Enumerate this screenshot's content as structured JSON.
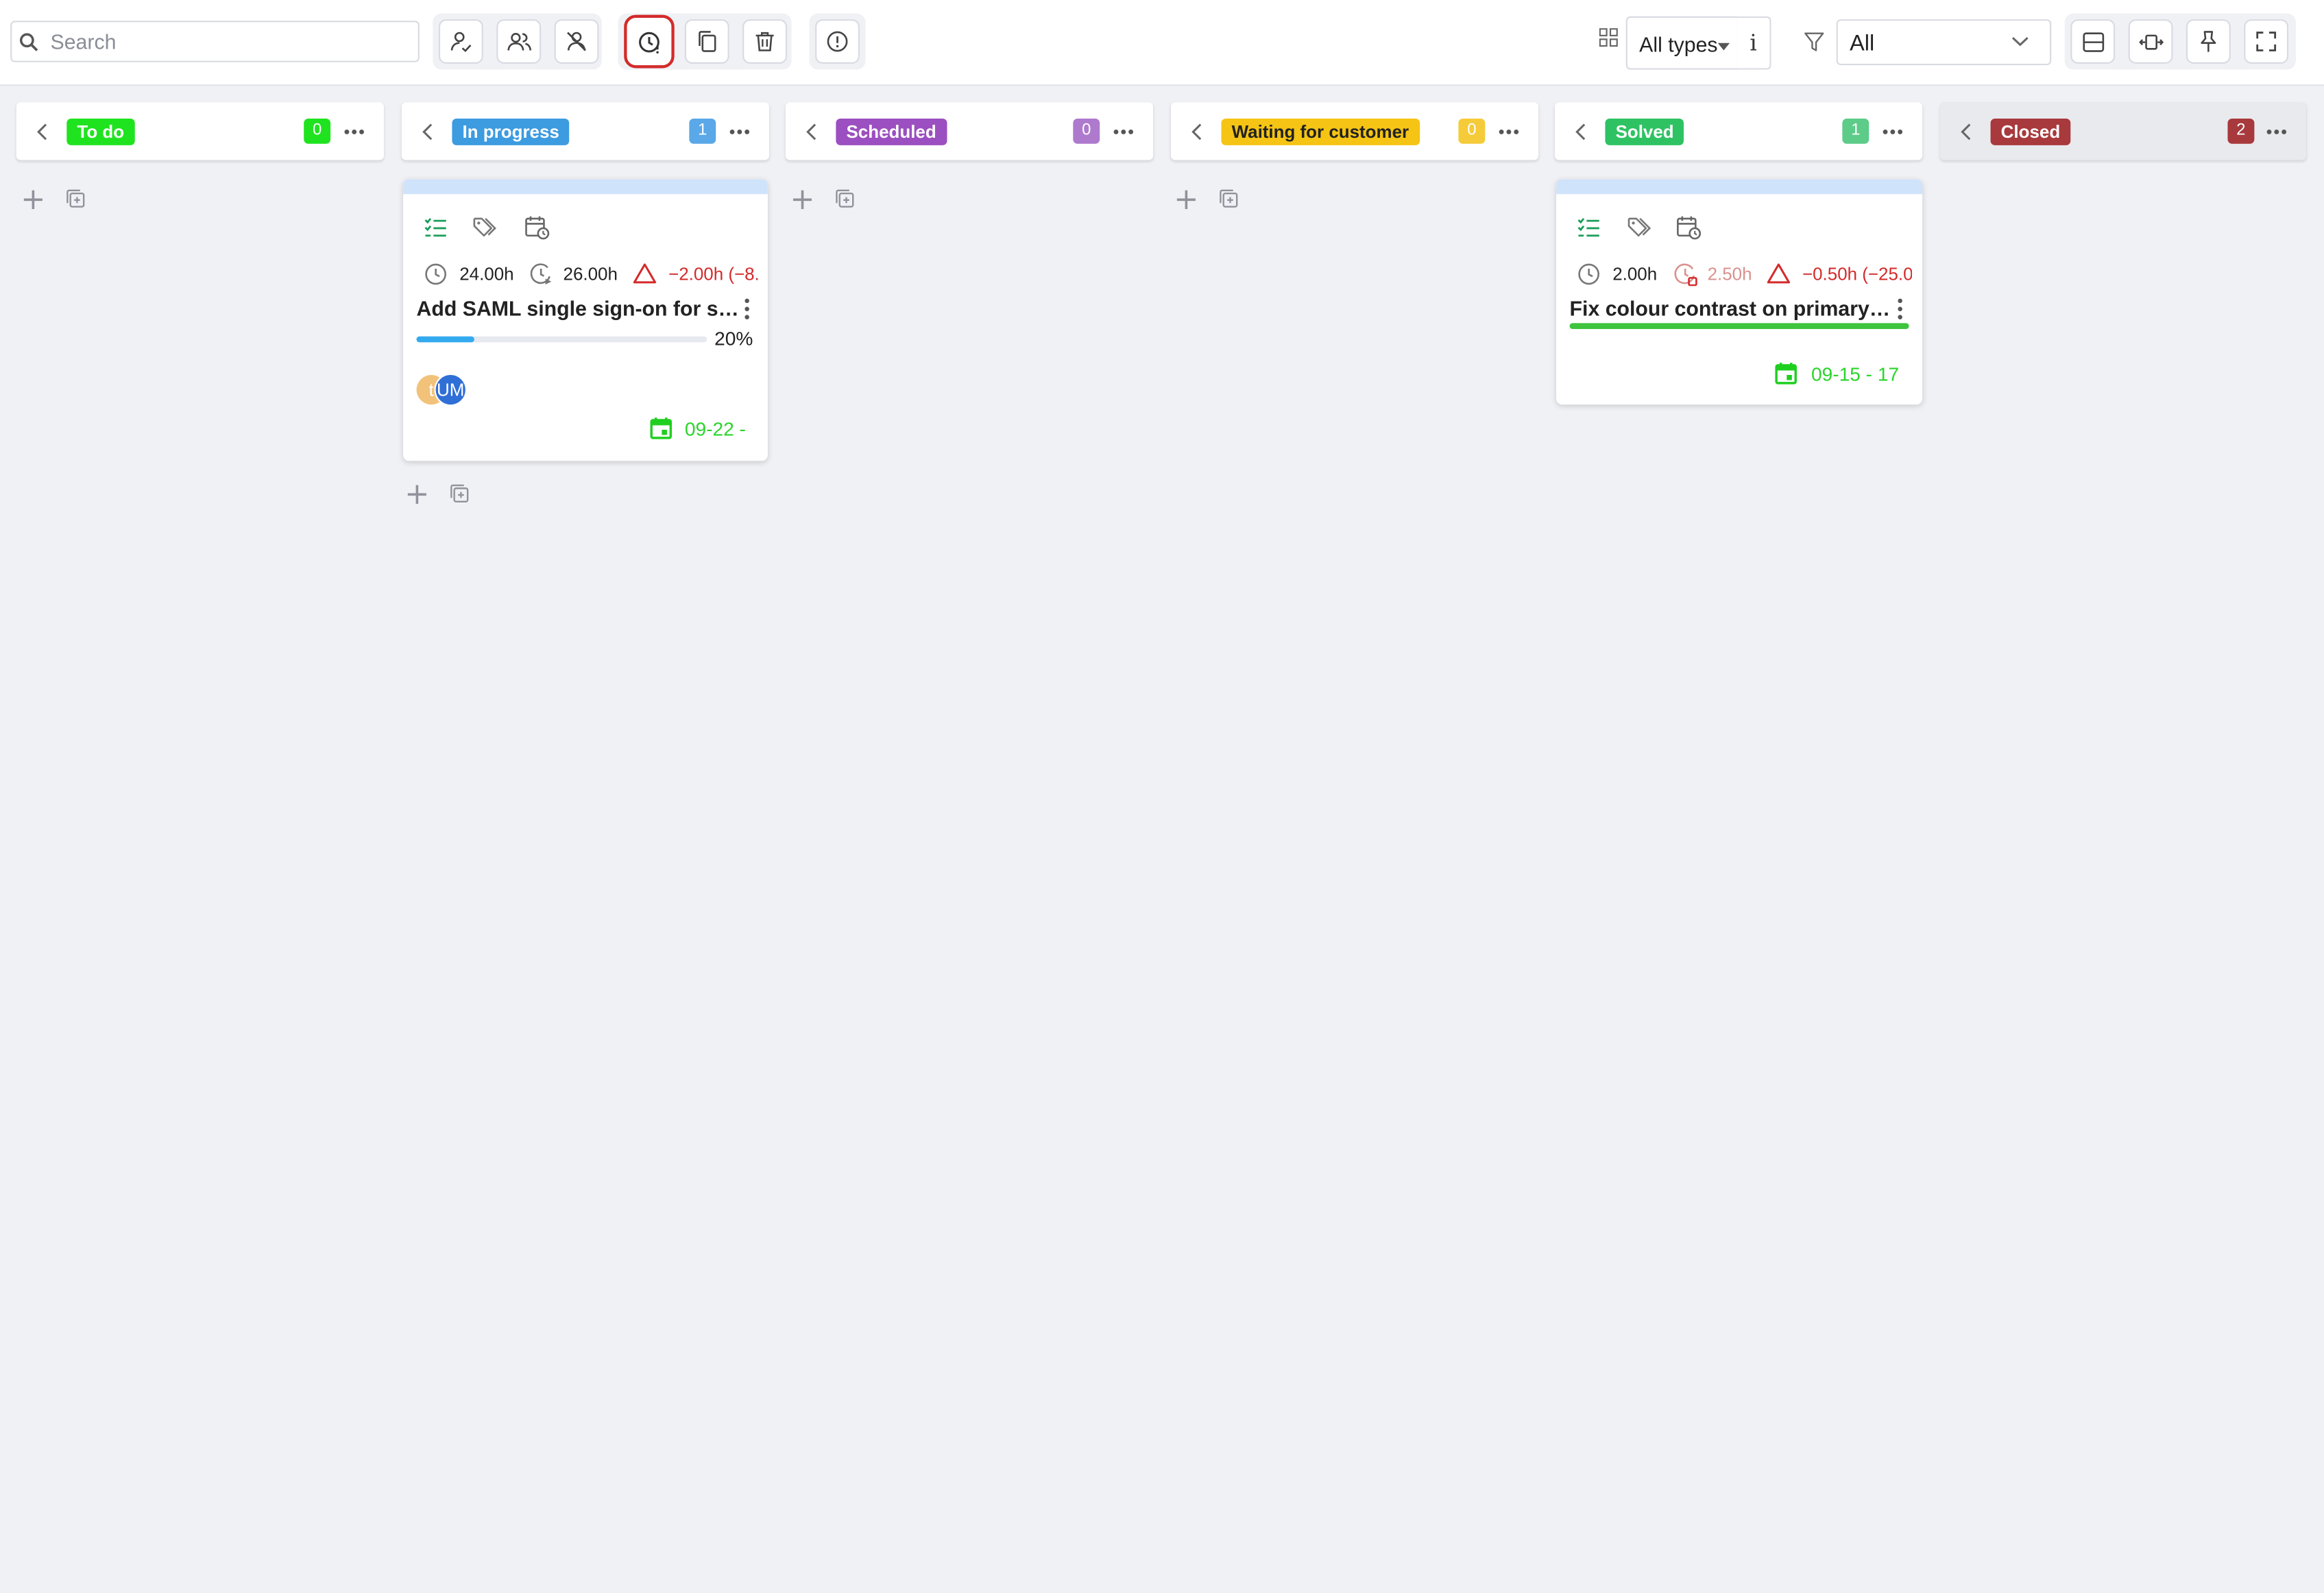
{
  "toolbar": {
    "search_placeholder": "Search",
    "types_label": "All types",
    "info_label": "i",
    "filter_value": "All"
  },
  "colors": {
    "accent_active": "#d32b2b",
    "background": "#f0f1f5"
  },
  "columns": [
    {
      "label": "To do",
      "count": "0",
      "tag_color": "#20e320",
      "badge_color": "#20e320"
    },
    {
      "label": "In progress",
      "count": "1",
      "tag_color": "#3d9be0",
      "badge_color": "#5aa8e8"
    },
    {
      "label": "Scheduled",
      "count": "0",
      "tag_color": "#9b4fc0",
      "badge_color": "#ae7acd"
    },
    {
      "label": "Waiting for customer",
      "count": "0",
      "tag_color": "#f5c414",
      "badge_color": "#f5cb3a",
      "tag_text_color": "#222222"
    },
    {
      "label": "Solved",
      "count": "1",
      "tag_color": "#2ec263",
      "badge_color": "#5ccc88"
    },
    {
      "label": "Closed",
      "count": "2",
      "tag_color": "#a8393c",
      "badge_color": "#a8393c"
    }
  ],
  "cards": [
    {
      "column": "In progress",
      "estimate": "24.00h",
      "spent": "26.00h",
      "overrun": "−2.00h (−8.",
      "title": "Add SAML single sign-on for staf...",
      "progress": 0.2,
      "progress_label": "20%",
      "avatars": [
        "t",
        "UM"
      ],
      "date": "09-22 -"
    },
    {
      "column": "Solved",
      "estimate": "2.00h",
      "spent": "2.50h",
      "overrun": "−0.50h (−25.0",
      "title": "Fix colour contrast on primary b...",
      "date": "09-15 - 17"
    }
  ]
}
